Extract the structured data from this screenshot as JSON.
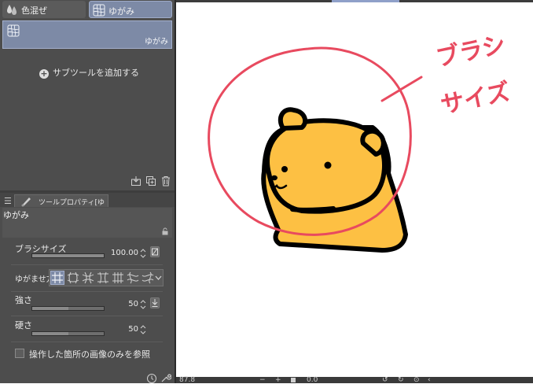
{
  "tabs": [
    {
      "label": "色混ぜ",
      "icon": "color-mix-icon",
      "selected": false
    },
    {
      "label": "ゆがみ",
      "icon": "liquify-icon",
      "selected": true
    }
  ],
  "subtool": {
    "name": "ゆがみ",
    "icon": "liquify-icon"
  },
  "add_subtool": "サブツールを追加する",
  "tool_property": {
    "tab_title": "ツールプロパティ[ゆがみ]",
    "tool_name": "ゆがみ",
    "brush_size": {
      "label": "ブラシサイズ",
      "value": "100.00",
      "fill": 1.0
    },
    "method": {
      "label": "ゆがませ方",
      "selected_index": 0
    },
    "strength": {
      "label": "強さ",
      "value": "50",
      "fill": 0.5
    },
    "hardness": {
      "label": "硬さ",
      "value": "50",
      "fill": 0.5
    },
    "reference_checkbox": {
      "label": "操作した箇所の画像のみを参照",
      "checked": false
    }
  },
  "statusbar": {
    "zoom": "87.8",
    "rotation": "0.0"
  },
  "annotation": {
    "line1": "ブラシ",
    "line2": "サイズ"
  },
  "colors": {
    "brush_circle": "#e84a5f",
    "bear_fill": "#fdc043",
    "selection": "#7d8aa6"
  }
}
